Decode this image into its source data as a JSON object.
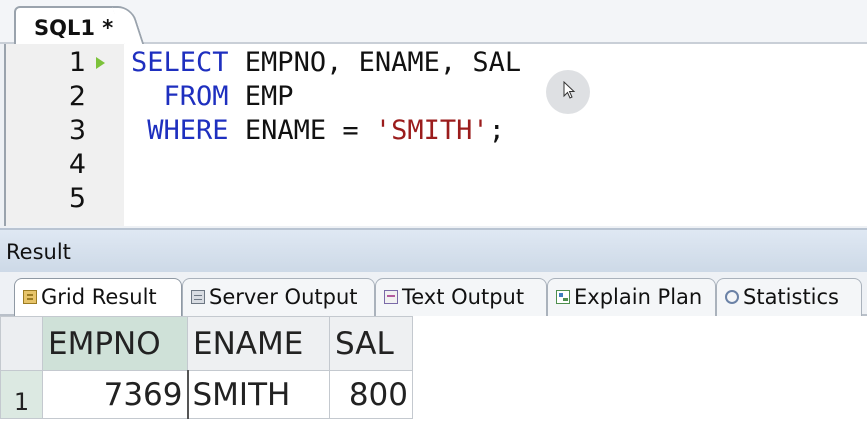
{
  "editor": {
    "tab_label": "SQL1 *",
    "lines": [
      {
        "num": "1",
        "parts": [
          {
            "cls": "kw",
            "text": "SELECT "
          },
          {
            "cls": "",
            "text": "EMPNO, ENAME, SAL"
          }
        ]
      },
      {
        "num": "2",
        "parts": [
          {
            "cls": "",
            "text": "  "
          },
          {
            "cls": "kw",
            "text": "FROM "
          },
          {
            "cls": "",
            "text": "EMP"
          }
        ]
      },
      {
        "num": "3",
        "parts": [
          {
            "cls": "",
            "text": " "
          },
          {
            "cls": "kw",
            "text": "WHERE "
          },
          {
            "cls": "",
            "text": "ENAME = "
          },
          {
            "cls": "str",
            "text": "'SMITH'"
          },
          {
            "cls": "",
            "text": ";"
          }
        ]
      },
      {
        "num": "4",
        "parts": []
      },
      {
        "num": "5",
        "parts": []
      }
    ]
  },
  "result": {
    "title": "Result",
    "tabs": [
      {
        "label": "Grid Result",
        "icon": "grid-result-icon",
        "active": true
      },
      {
        "label": "Server Output",
        "icon": "server-output-icon",
        "active": false
      },
      {
        "label": "Text Output",
        "icon": "text-output-icon",
        "active": false
      },
      {
        "label": "Explain Plan",
        "icon": "explain-plan-icon",
        "active": false
      },
      {
        "label": "Statistics",
        "icon": "statistics-icon",
        "active": false
      }
    ],
    "grid": {
      "columns": [
        "EMPNO",
        "ENAME",
        "SAL"
      ],
      "rows": [
        {
          "row_num": "1",
          "cells": [
            "7369",
            "SMITH",
            "800"
          ]
        }
      ]
    }
  },
  "colors": {
    "keyword": "#1e2fbf",
    "string": "#9b1c1c",
    "exec_marker": "#7cc23a",
    "selected_header": "#cfe1d8"
  }
}
